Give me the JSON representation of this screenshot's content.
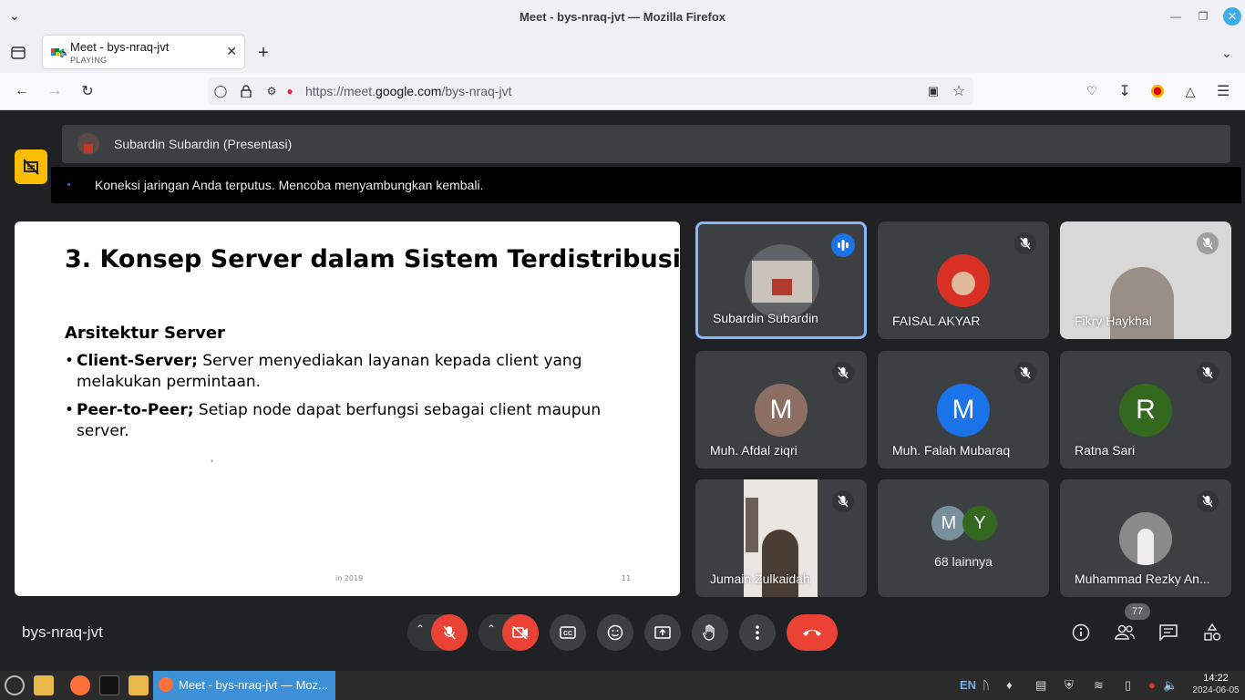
{
  "window": {
    "title": "Meet - bys-nraq-jvt — Mozilla Firefox"
  },
  "browser": {
    "tab": {
      "title": "Meet - bys-nraq-jvt",
      "status": "PLAYING"
    },
    "url_prefix": "https://meet.",
    "url_domain": "google.com",
    "url_path": "/bys-nraq-jvt"
  },
  "meet": {
    "presenter_label": "Subardin Subardin (Presentasi)",
    "notification": "Koneksi jaringan Anda terputus. Mencoba menyambungkan kembali.",
    "meeting_code": "bys-nraq-jvt",
    "people_count": "77"
  },
  "slide": {
    "title": "3. Konsep Server dalam Sistem Terdistribusi",
    "subtitle": "Arsitektur Server",
    "bullet1_bold": "Client-Server;",
    "bullet1_text": " Server menyediakan layanan kepada client yang melakukan permintaan.",
    "bullet2_bold": "Peer-to-Peer;",
    "bullet2_text": " Setiap node dapat berfungsi sebagai client maupun server.",
    "footer_left": "in 2019",
    "footer_right": "11"
  },
  "participants": [
    {
      "name": "Subardin Subardin",
      "state": "speaking",
      "color": "#5f6368"
    },
    {
      "name": "FAISAL AKYAR",
      "state": "muted",
      "color": "#d93025"
    },
    {
      "name": "Fikry Haykhal",
      "state": "muted",
      "color": "#cfcfcf"
    },
    {
      "name": "Muh. Afdal ziqri",
      "initial": "M",
      "state": "muted",
      "color": "#8d6e63"
    },
    {
      "name": "Muh. Falah Mubaraq",
      "initial": "M",
      "state": "muted",
      "color": "#1a73e8"
    },
    {
      "name": "Ratna Sari",
      "initial": "R",
      "state": "muted",
      "color": "#33691e"
    },
    {
      "name": "Jumain Zulkaidah",
      "state": "muted",
      "color": "#6d5c4e"
    },
    {
      "name": "68 lainnya",
      "initials": [
        "M",
        "Y"
      ],
      "colors": [
        "#78909c",
        "#33691e"
      ]
    },
    {
      "name": "Muhammad Rezky An...",
      "state": "muted",
      "color": "#8a8a8a"
    }
  ],
  "taskbar": {
    "active_window": "Meet - bys-nraq-jvt — Moz...",
    "lang": "EN",
    "time": "14:22",
    "date": "2024-06-05"
  }
}
